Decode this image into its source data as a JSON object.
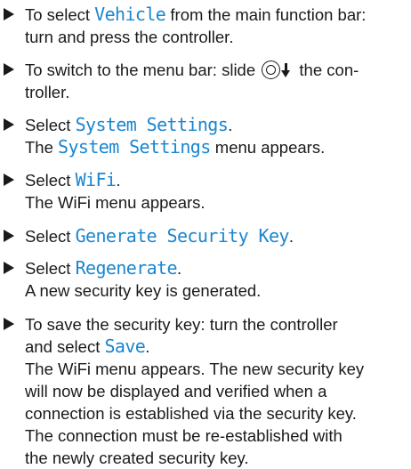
{
  "steps": [
    {
      "lines": [
        {
          "pre": "To select ",
          "ui": "Vehicle",
          "post": " from the main function bar:"
        },
        {
          "text": "turn and press the controller."
        }
      ]
    },
    {
      "lines": [
        {
          "pre": "To switch to the menu bar: slide ",
          "post": " the con-"
        },
        {
          "text": "troller."
        }
      ]
    },
    {
      "lines": [
        {
          "pre": "Select ",
          "ui": "System Settings",
          "post": "."
        },
        {
          "pre": "The ",
          "ui": "System Settings",
          "post": " menu appears."
        }
      ]
    },
    {
      "lines": [
        {
          "pre": "Select ",
          "ui": "WiFi",
          "post": "."
        },
        {
          "text": "The WiFi menu appears."
        }
      ]
    },
    {
      "lines": [
        {
          "pre": "Select ",
          "ui": "Generate Security Key",
          "post": "."
        }
      ]
    },
    {
      "lines": [
        {
          "pre": "Select ",
          "ui": "Regenerate",
          "post": "."
        },
        {
          "text": "A new security key is generated."
        }
      ]
    },
    {
      "lines": [
        {
          "text": "To save the security key: turn the controller"
        },
        {
          "pre": "and select ",
          "ui": "Save",
          "post": "."
        },
        {
          "text": "The WiFi menu appears. The new security key"
        },
        {
          "text": "will now be displayed and verified when a"
        },
        {
          "text": "connection is established via the security key."
        },
        {
          "text": "The connection must be re-established with"
        },
        {
          "text": "the newly created security key."
        }
      ]
    }
  ],
  "icons": {
    "controller_slide": "controller-knob-icon",
    "direction": "down-arrow-icon"
  },
  "colors": {
    "ui_text": "#1a86d0",
    "body_text": "#1a1a1a"
  }
}
